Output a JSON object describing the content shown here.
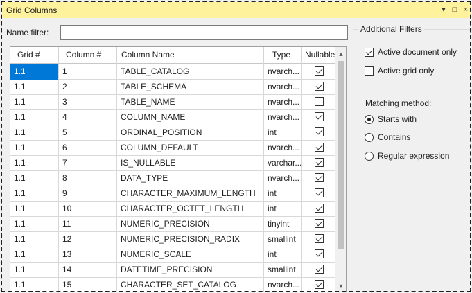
{
  "panel": {
    "title": "Grid Columns",
    "buttons": {
      "menu": "▾",
      "maximize": "□",
      "close": "×"
    }
  },
  "filter": {
    "label": "Name filter:",
    "value": "",
    "placeholder": ""
  },
  "grid": {
    "headers": [
      "Grid #",
      "Column #",
      "Column Name",
      "Type",
      "Nullable"
    ],
    "rows": [
      {
        "grid": "1.1",
        "col": "1",
        "name": "TABLE_CATALOG",
        "type": "nvarch...",
        "nullable": true
      },
      {
        "grid": "1.1",
        "col": "2",
        "name": "TABLE_SCHEMA",
        "type": "nvarch...",
        "nullable": true
      },
      {
        "grid": "1.1",
        "col": "3",
        "name": "TABLE_NAME",
        "type": "nvarch...",
        "nullable": false
      },
      {
        "grid": "1.1",
        "col": "4",
        "name": "COLUMN_NAME",
        "type": "nvarch...",
        "nullable": true
      },
      {
        "grid": "1.1",
        "col": "5",
        "name": "ORDINAL_POSITION",
        "type": "int",
        "nullable": true
      },
      {
        "grid": "1.1",
        "col": "6",
        "name": "COLUMN_DEFAULT",
        "type": "nvarch...",
        "nullable": true
      },
      {
        "grid": "1.1",
        "col": "7",
        "name": "IS_NULLABLE",
        "type": "varchar...",
        "nullable": true
      },
      {
        "grid": "1.1",
        "col": "8",
        "name": "DATA_TYPE",
        "type": "nvarch...",
        "nullable": true
      },
      {
        "grid": "1.1",
        "col": "9",
        "name": "CHARACTER_MAXIMUM_LENGTH",
        "type": "int",
        "nullable": true
      },
      {
        "grid": "1.1",
        "col": "10",
        "name": "CHARACTER_OCTET_LENGTH",
        "type": "int",
        "nullable": true
      },
      {
        "grid": "1.1",
        "col": "11",
        "name": "NUMERIC_PRECISION",
        "type": "tinyint",
        "nullable": true
      },
      {
        "grid": "1.1",
        "col": "12",
        "name": "NUMERIC_PRECISION_RADIX",
        "type": "smallint",
        "nullable": true
      },
      {
        "grid": "1.1",
        "col": "13",
        "name": "NUMERIC_SCALE",
        "type": "int",
        "nullable": true
      },
      {
        "grid": "1.1",
        "col": "14",
        "name": "DATETIME_PRECISION",
        "type": "smallint",
        "nullable": true
      },
      {
        "grid": "1.1",
        "col": "15",
        "name": "CHARACTER_SET_CATALOG",
        "type": "nvarch...",
        "nullable": true
      }
    ],
    "scroll_up": "▲",
    "scroll_down": "▼"
  },
  "filters": {
    "title": "Additional Filters",
    "active_document": {
      "label": "Active document only",
      "checked": true
    },
    "active_grid": {
      "label": "Active grid only",
      "checked": false
    },
    "matching_label": "Matching method:",
    "methods": [
      {
        "label": "Starts with",
        "selected": true
      },
      {
        "label": "Contains",
        "selected": false
      },
      {
        "label": "Regular expression",
        "selected": false
      }
    ]
  },
  "colors": {
    "titlebar": "#fff29d",
    "selection": "#0078d7",
    "panel": "#f0f0f0"
  }
}
